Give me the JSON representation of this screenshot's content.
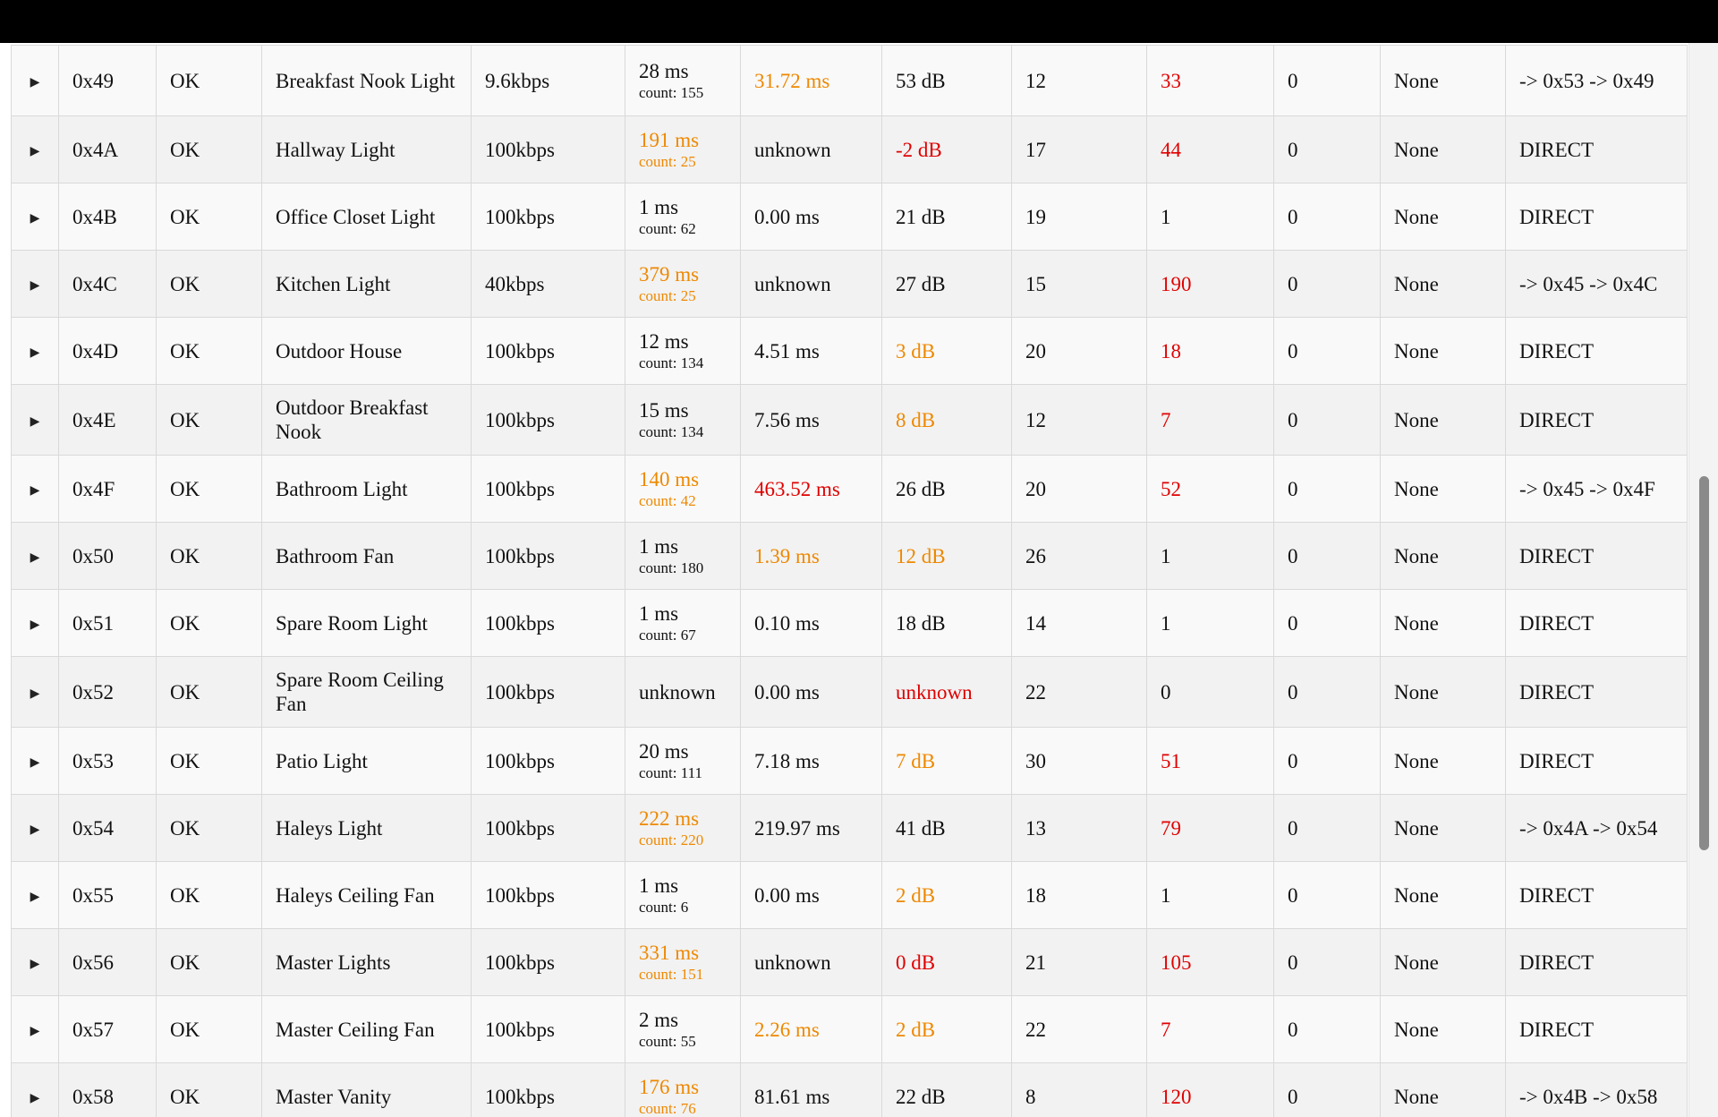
{
  "colors": {
    "warning": "#ee8800",
    "error": "#e00000",
    "text": "#111111",
    "topbar": "#000000"
  },
  "icons": {
    "expand": "right-triangle-icon"
  },
  "rows": [
    {
      "caret": "▶",
      "node": "0x49",
      "status": "OK",
      "name": "Breakfast Nook Light",
      "speed": "9.6kbps",
      "rtt": "28 ms",
      "count": "count: 155",
      "rtt_level": "normal",
      "latency": "31.72 ms",
      "latency_level": "warning",
      "snr": "53 dB",
      "snr_level": "normal",
      "c1": "12",
      "c2": "33",
      "c2_level": "error",
      "c3": "0",
      "failed": "None",
      "route": "-> 0x53 -> 0x49"
    },
    {
      "caret": "▶",
      "node": "0x4A",
      "status": "OK",
      "name": "Hallway Light",
      "speed": "100kbps",
      "rtt": "191 ms",
      "count": "count: 25",
      "rtt_level": "warning",
      "latency": "unknown",
      "latency_level": "normal",
      "snr": "-2 dB",
      "snr_level": "error",
      "c1": "17",
      "c2": "44",
      "c2_level": "error",
      "c3": "0",
      "failed": "None",
      "route": "DIRECT"
    },
    {
      "caret": "▶",
      "node": "0x4B",
      "status": "OK",
      "name": "Office Closet Light",
      "speed": "100kbps",
      "rtt": "1 ms",
      "count": "count: 62",
      "rtt_level": "normal",
      "latency": "0.00 ms",
      "latency_level": "normal",
      "snr": "21 dB",
      "snr_level": "normal",
      "c1": "19",
      "c2": "1",
      "c2_level": "normal",
      "c3": "0",
      "failed": "None",
      "route": "DIRECT"
    },
    {
      "caret": "▶",
      "node": "0x4C",
      "status": "OK",
      "name": "Kitchen Light",
      "speed": "40kbps",
      "rtt": "379 ms",
      "count": "count: 25",
      "rtt_level": "warning",
      "latency": "unknown",
      "latency_level": "normal",
      "snr": "27 dB",
      "snr_level": "normal",
      "c1": "15",
      "c2": "190",
      "c2_level": "error",
      "c3": "0",
      "failed": "None",
      "route": "-> 0x45 -> 0x4C"
    },
    {
      "caret": "▶",
      "node": "0x4D",
      "status": "OK",
      "name": "Outdoor House",
      "speed": "100kbps",
      "rtt": "12 ms",
      "count": "count: 134",
      "rtt_level": "normal",
      "latency": "4.51 ms",
      "latency_level": "normal",
      "snr": "3 dB",
      "snr_level": "warning",
      "c1": "20",
      "c2": "18",
      "c2_level": "error",
      "c3": "0",
      "failed": "None",
      "route": "DIRECT"
    },
    {
      "caret": "▶",
      "node": "0x4E",
      "status": "OK",
      "name": "Outdoor Breakfast Nook",
      "speed": "100kbps",
      "rtt": "15 ms",
      "count": "count: 134",
      "rtt_level": "normal",
      "latency": "7.56 ms",
      "latency_level": "normal",
      "snr": "8 dB",
      "snr_level": "warning",
      "c1": "12",
      "c2": "7",
      "c2_level": "error",
      "c3": "0",
      "failed": "None",
      "route": "DIRECT"
    },
    {
      "caret": "▶",
      "node": "0x4F",
      "status": "OK",
      "name": "Bathroom Light",
      "speed": "100kbps",
      "rtt": "140 ms",
      "count": "count: 42",
      "rtt_level": "warning",
      "latency": "463.52 ms",
      "latency_level": "error",
      "snr": "26 dB",
      "snr_level": "normal",
      "c1": "20",
      "c2": "52",
      "c2_level": "error",
      "c3": "0",
      "failed": "None",
      "route": "-> 0x45 -> 0x4F"
    },
    {
      "caret": "▶",
      "node": "0x50",
      "status": "OK",
      "name": "Bathroom Fan",
      "speed": "100kbps",
      "rtt": "1 ms",
      "count": "count: 180",
      "rtt_level": "normal",
      "latency": "1.39 ms",
      "latency_level": "warning",
      "snr": "12 dB",
      "snr_level": "warning",
      "c1": "26",
      "c2": "1",
      "c2_level": "normal",
      "c3": "0",
      "failed": "None",
      "route": "DIRECT"
    },
    {
      "caret": "▶",
      "node": "0x51",
      "status": "OK",
      "name": "Spare Room Light",
      "speed": "100kbps",
      "rtt": "1 ms",
      "count": "count: 67",
      "rtt_level": "normal",
      "latency": "0.10 ms",
      "latency_level": "normal",
      "snr": "18 dB",
      "snr_level": "normal",
      "c1": "14",
      "c2": "1",
      "c2_level": "normal",
      "c3": "0",
      "failed": "None",
      "route": "DIRECT"
    },
    {
      "caret": "▶",
      "node": "0x52",
      "status": "OK",
      "name": "Spare Room Ceiling Fan",
      "speed": "100kbps",
      "rtt": "unknown",
      "count": "",
      "rtt_level": "normal",
      "latency": "0.00 ms",
      "latency_level": "normal",
      "snr": "unknown",
      "snr_level": "error",
      "c1": "22",
      "c2": "0",
      "c2_level": "normal",
      "c3": "0",
      "failed": "None",
      "route": "DIRECT"
    },
    {
      "caret": "▶",
      "node": "0x53",
      "status": "OK",
      "name": "Patio Light",
      "speed": "100kbps",
      "rtt": "20 ms",
      "count": "count: 111",
      "rtt_level": "normal",
      "latency": "7.18 ms",
      "latency_level": "normal",
      "snr": "7 dB",
      "snr_level": "warning",
      "c1": "30",
      "c2": "51",
      "c2_level": "error",
      "c3": "0",
      "failed": "None",
      "route": "DIRECT"
    },
    {
      "caret": "▶",
      "node": "0x54",
      "status": "OK",
      "name": "Haleys Light",
      "speed": "100kbps",
      "rtt": "222 ms",
      "count": "count: 220",
      "rtt_level": "warning",
      "latency": "219.97 ms",
      "latency_level": "normal",
      "snr": "41 dB",
      "snr_level": "normal",
      "c1": "13",
      "c2": "79",
      "c2_level": "error",
      "c3": "0",
      "failed": "None",
      "route": "-> 0x4A -> 0x54"
    },
    {
      "caret": "▶",
      "node": "0x55",
      "status": "OK",
      "name": "Haleys Ceiling Fan",
      "speed": "100kbps",
      "rtt": "1 ms",
      "count": "count: 6",
      "rtt_level": "normal",
      "latency": "0.00 ms",
      "latency_level": "normal",
      "snr": "2 dB",
      "snr_level": "warning",
      "c1": "18",
      "c2": "1",
      "c2_level": "normal",
      "c3": "0",
      "failed": "None",
      "route": "DIRECT"
    },
    {
      "caret": "▶",
      "node": "0x56",
      "status": "OK",
      "name": "Master Lights",
      "speed": "100kbps",
      "rtt": "331 ms",
      "count": "count: 151",
      "rtt_level": "warning",
      "latency": "unknown",
      "latency_level": "normal",
      "snr": "0 dB",
      "snr_level": "error",
      "c1": "21",
      "c2": "105",
      "c2_level": "error",
      "c3": "0",
      "failed": "None",
      "route": "DIRECT"
    },
    {
      "caret": "▶",
      "node": "0x57",
      "status": "OK",
      "name": "Master Ceiling Fan",
      "speed": "100kbps",
      "rtt": "2 ms",
      "count": "count: 55",
      "rtt_level": "normal",
      "latency": "2.26 ms",
      "latency_level": "warning",
      "snr": "2 dB",
      "snr_level": "warning",
      "c1": "22",
      "c2": "7",
      "c2_level": "error",
      "c3": "0",
      "failed": "None",
      "route": "DIRECT"
    },
    {
      "caret": "▶",
      "node": "0x58",
      "status": "OK",
      "name": "Master Vanity",
      "speed": "100kbps",
      "rtt": "176 ms",
      "count": "count: 76",
      "rtt_level": "warning",
      "latency": "81.61 ms",
      "latency_level": "normal",
      "snr": "22 dB",
      "snr_level": "normal",
      "c1": "8",
      "c2": "120",
      "c2_level": "error",
      "c3": "0",
      "failed": "None",
      "route": "-> 0x4B -> 0x58"
    }
  ]
}
